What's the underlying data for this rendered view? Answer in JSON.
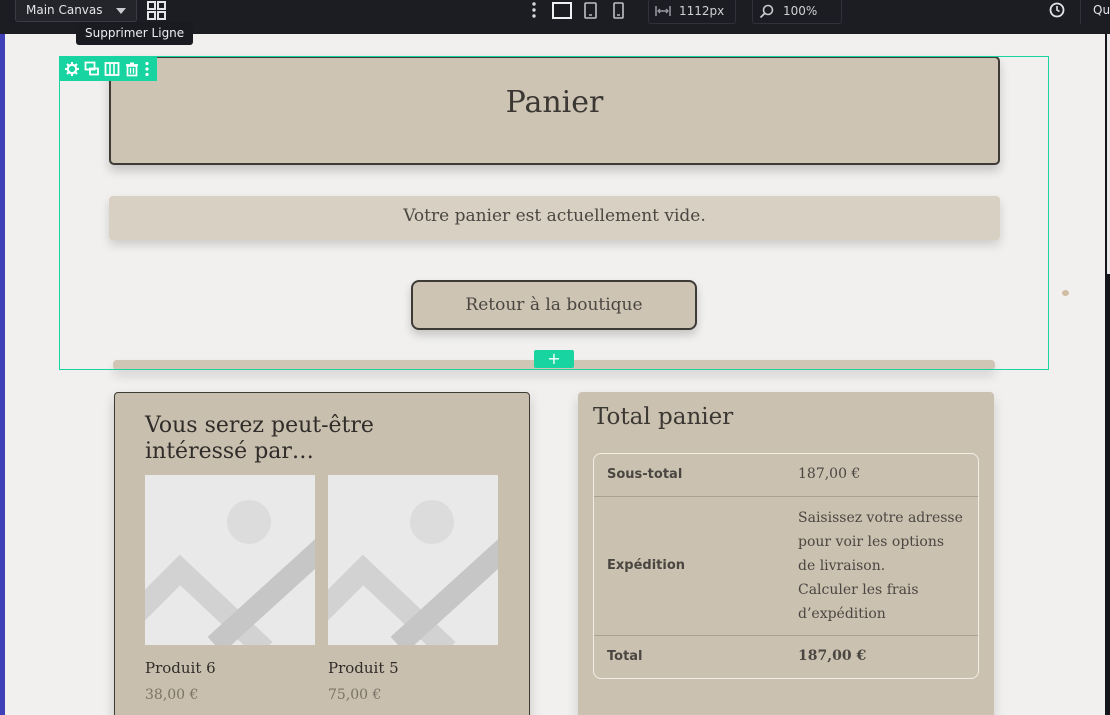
{
  "toolbar": {
    "canvas_select": "Main Canvas",
    "tooltip": "Supprimer Ligne",
    "width_value": "1112px",
    "zoom_value": "100%",
    "right_label": "Qui"
  },
  "page": {
    "title": "Panier",
    "empty_message": "Votre panier est actuellement vide.",
    "back_button": "Retour à la boutique"
  },
  "cross_sells": {
    "heading": "Vous serez peut-être intéressé par…",
    "products": [
      {
        "name": "Produit 6",
        "price": "38,00 €"
      },
      {
        "name": "Produit 5",
        "price": "75,00 €"
      }
    ]
  },
  "cart_totals": {
    "heading": "Total panier",
    "subtotal_label": "Sous-total",
    "subtotal_value": "187,00 €",
    "shipping_label": "Expédition",
    "shipping_line1": "Saisissez votre adresse",
    "shipping_line2": "pour voir les options",
    "shipping_line3": "de livraison.",
    "shipping_link1": "Calculer les frais",
    "shipping_link2": "d’expédition",
    "total_label": "Total",
    "total_value": "187,00 €"
  },
  "colors": {
    "accent": "#17d4a0",
    "panel": "#cdc4b4",
    "canvas_bg": "#f1f0ee",
    "toolbar_bg": "#1c1d22"
  }
}
